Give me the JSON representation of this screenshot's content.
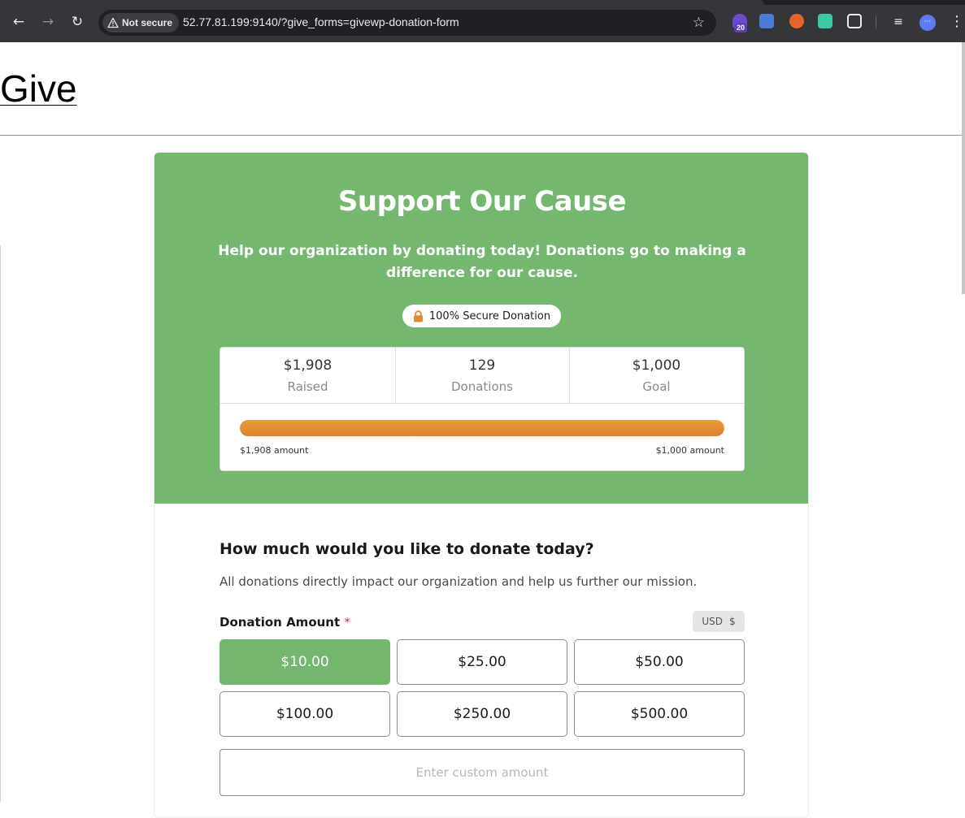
{
  "browser": {
    "security_label": "Not secure",
    "url": "52.77.81.199:9140/?give_forms=givewp-donation-form",
    "extension_badge": "20"
  },
  "site": {
    "title": "Give"
  },
  "hero": {
    "title": "Support Our Cause",
    "description": "Help our organization by donating today! Donations go to making a difference for our cause.",
    "secure_label": "100% Secure Donation",
    "color": "#74b870"
  },
  "stats": {
    "raised": {
      "value": "$1,908",
      "label": "Raised"
    },
    "donations": {
      "value": "129",
      "label": "Donations"
    },
    "goal": {
      "value": "$1,000",
      "label": "Goal"
    },
    "progress_fraction": 1.0,
    "progress_left": "$1,908 amount",
    "progress_right": "$1,000 amount",
    "progress_color": "#e08c35"
  },
  "form": {
    "heading": "How much would you like to donate today?",
    "description": "All donations directly impact our organization and help us further our mission.",
    "amount_label": "Donation Amount",
    "required_mark": "*",
    "currency_code": "USD",
    "currency_symbol": "$",
    "amounts": [
      "$10.00",
      "$25.00",
      "$50.00",
      "$100.00",
      "$250.00",
      "$500.00"
    ],
    "selected_index": 0,
    "custom_placeholder": "Enter custom amount"
  }
}
